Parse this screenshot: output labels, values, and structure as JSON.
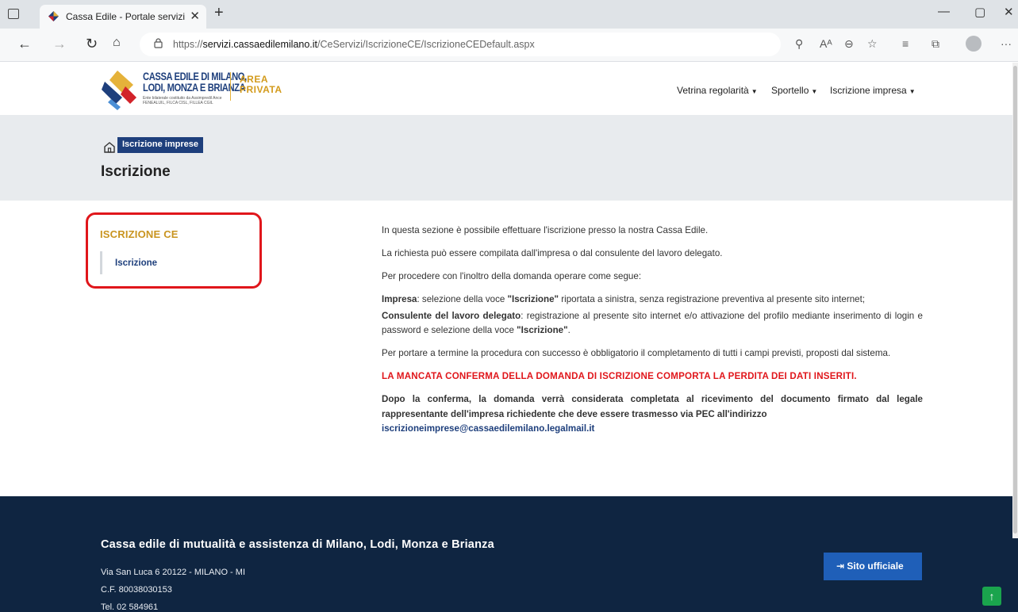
{
  "browser": {
    "tab_title": "Cassa Edile - Portale servizi",
    "tab_close": "✕",
    "new_tab": "+",
    "url_prefix": "https://",
    "url_domain": "servizi.cassaedilemilano.it",
    "url_path": "/CeServizi/IscrizioneCE/IscrizioneCEDefault.aspx"
  },
  "header": {
    "logo_line1": "CASSA EDILE DI MILANO,",
    "logo_line2": "LODI, MONZA E BRIANZA",
    "logo_line3a": "Ente bilaterale costituito da Assimpredil Ance",
    "logo_line3b": "FENEALUIL, FILCA CISL, FILLEA CGIL",
    "area_line1": "AREA",
    "area_line2": "PRIVATA",
    "nav": [
      {
        "label": "Vetrina regolarità"
      },
      {
        "label": "Sportello"
      },
      {
        "label": "Iscrizione impresa"
      }
    ]
  },
  "hero": {
    "breadcrumb": "Iscrizione imprese",
    "title": "Iscrizione"
  },
  "sidebar": {
    "title": "ISCRIZIONE CE",
    "item": "Iscrizione"
  },
  "content": {
    "p1": "In questa sezione è possibile effettuare l'iscrizione presso la nostra Cassa Edile.",
    "p2": "La richiesta può essere compilata dall'impresa o dal consulente del lavoro delegato.",
    "p3": "Per procedere con l'inoltro della domanda operare come segue:",
    "impresa_label": "Impresa",
    "impresa_text_a": ": selezione della voce ",
    "impresa_voce": "\"Iscrizione\"",
    "impresa_text_b": " riportata a sinistra, senza registrazione preventiva al presente sito internet;",
    "consulente_label": "Consulente del lavoro delegato",
    "consulente_text_a": ": registrazione al presente sito internet e/o attivazione del profilo mediante inserimento di login e password e selezione della voce ",
    "consulente_voce": "\"Iscrizione\"",
    "consulente_text_b": ".",
    "p5": "Per portare a termine la procedura con successo è obbligatorio il completamento di tutti i campi previsti, proposti dal sistema.",
    "warning": "LA MANCATA CONFERMA DELLA DOMANDA DI ISCRIZIONE COMPORTA LA PERDITA DEI DATI INSERITI.",
    "final_text": "Dopo la conferma, la domanda verrà considerata completata al ricevimento del documento firmato dal legale rappresentante dell'impresa richiedente che deve essere trasmesso via PEC all'indirizzo",
    "email": "iscrizioneimprese@cassaedilemilano.legalmail.it"
  },
  "footer": {
    "title": "Cassa edile di mutualità e assistenza di Milano, Lodi, Monza e Brianza",
    "address": "Via San Luca 6 20122 - MILANO - MI",
    "cf": "C.F. 80038030153",
    "tel": "Tel. 02 584961",
    "official_button": "Sito ufficiale"
  },
  "colors": {
    "navy": "#1e3f7c",
    "gold": "#c9941f",
    "red": "#e0161b",
    "footer_bg": "#0f2541",
    "button_blue": "#1f5fb8"
  }
}
